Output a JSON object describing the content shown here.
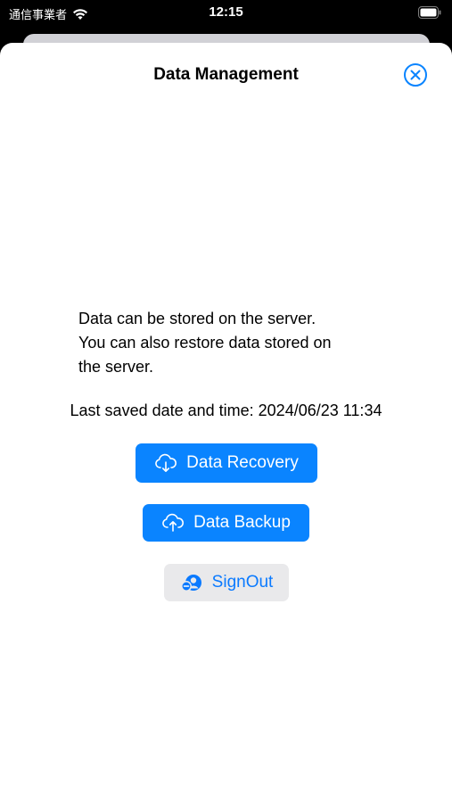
{
  "status_bar": {
    "carrier": "通信事業者",
    "time": "12:15"
  },
  "sheet": {
    "title": "Data Management",
    "description_lines": [
      "Data can be stored on the server.",
      "You can also restore data stored on",
      "the server."
    ],
    "last_saved": "Last saved date and time: 2024/06/23 11:34"
  },
  "buttons": {
    "recovery": "Data Recovery",
    "backup": "Data Backup",
    "signout": "SignOut"
  },
  "icons": {
    "wifi": "wifi-icon",
    "battery": "battery-icon",
    "close": "close-circle-icon",
    "recovery": "cloud-download-icon",
    "backup": "cloud-upload-icon",
    "signout": "person-minus-icon"
  },
  "colors": {
    "accent": "#0a84ff",
    "secondary_bg": "#e9e9eb",
    "sheet_bg": "#ffffff",
    "status_bg": "#000000"
  }
}
